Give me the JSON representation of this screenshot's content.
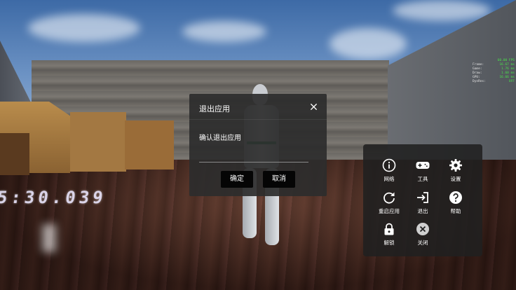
{
  "stats": {
    "fps": "60.00 FPS",
    "rows": [
      {
        "label": "Frame:",
        "value": "16.67 ms"
      },
      {
        "label": "Game:",
        "value": "1.76 ms"
      },
      {
        "label": "Draw:",
        "value": "1.60 ms"
      },
      {
        "label": "GPU:",
        "value": "16.66 ms"
      },
      {
        "label": "DynRes:",
        "value": "OFF"
      }
    ]
  },
  "scene": {
    "floor_text": "5:30.039"
  },
  "dialog": {
    "title": "退出应用",
    "close_icon": "close-icon",
    "message": "确认退出应用",
    "confirm_label": "确定",
    "cancel_label": "取消"
  },
  "menu": {
    "items": [
      {
        "label": "网络",
        "icon": "info-icon"
      },
      {
        "label": "工具",
        "icon": "gamepad-icon"
      },
      {
        "label": "设置",
        "icon": "gear-icon"
      },
      {
        "label": "重启应用",
        "icon": "refresh-icon"
      },
      {
        "label": "退出",
        "icon": "exit-icon"
      },
      {
        "label": "帮助",
        "icon": "help-icon"
      },
      {
        "label": "解锁",
        "icon": "lock-icon"
      },
      {
        "label": "关闭",
        "icon": "close-circle-icon"
      }
    ]
  },
  "colors": {
    "stats_value": "#49e34a",
    "dialog_bg": "#2c2c2c",
    "button_bg": "#050505",
    "panel_bg": "#202020"
  }
}
